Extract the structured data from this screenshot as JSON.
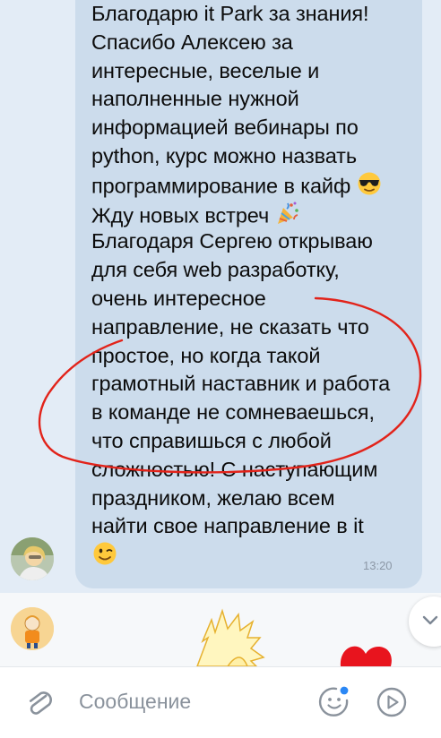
{
  "message": {
    "lines": [
      "Благодарю it Park за знания!",
      "Спасибо Алексею за",
      "интересные, веселые и",
      "наполненные нужной",
      "информацией вебинары по",
      "python, курс можно назвать",
      "программирование в кайф",
      "Жду новых встреч",
      "Благодаря Сергею открываю",
      "для себя web разработку,",
      "очень интересное",
      "направление, не сказать что",
      "простое, но когда такой",
      "грамотный наставник и работа",
      "в команде не сомневаешься,",
      "что справишься с любой",
      "сложностью! С наступающим",
      "праздником, желаю всем",
      "найти свое направление в it",
      ""
    ],
    "time": "13:20",
    "emojis": [
      "sunglasses-emoji",
      "party-popper-emoji",
      "winking-emoji"
    ]
  },
  "composer": {
    "placeholder": "Сообщение"
  },
  "colors": {
    "chat_bg": "#e3ecf6",
    "bubble": "#ccdcec",
    "annotation_red": "#e2231a",
    "input_text": "#8a929c",
    "icon_gray": "#8a929c",
    "notify_dot": "#2a87f5"
  },
  "icons": {
    "attach": "paperclip-icon",
    "sticker": "smiley-sticker-icon",
    "send": "play-circle-icon",
    "scroll": "chevron-down-icon"
  }
}
